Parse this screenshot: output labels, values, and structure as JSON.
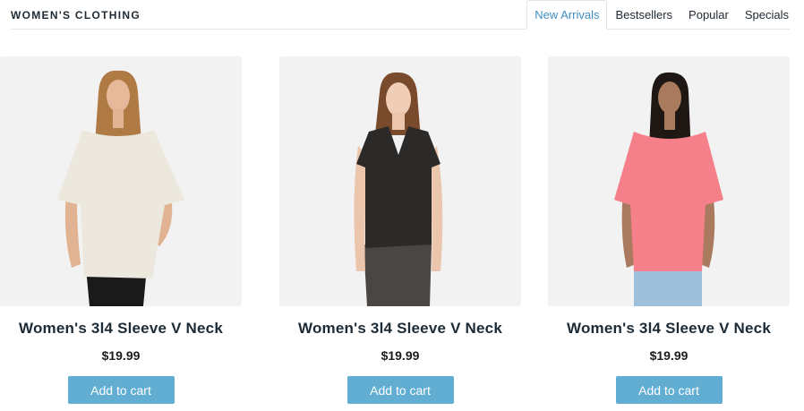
{
  "header": {
    "brand": "WOMEN'S CLOTHING",
    "tabs": [
      {
        "label": "New Arrivals",
        "active": true
      },
      {
        "label": "Bestsellers",
        "active": false
      },
      {
        "label": "Popular",
        "active": false
      },
      {
        "label": "Specials",
        "active": false
      }
    ]
  },
  "products": [
    {
      "title": "Women's 3l4 Sleeve V Neck",
      "price": "$19.99",
      "button": "Add to cart",
      "image": "model-black-top-photo",
      "top_color": "#2b2a28"
    },
    {
      "title": "Women's 3l4 Sleeve V Neck",
      "price": "$19.99",
      "button": "Add to cart",
      "image": "model-coral-top-photo",
      "top_color": "#f5808a"
    },
    {
      "title": "Women's 3l4 Sleeve V Neck",
      "price": "$19.99",
      "button": "Add to cart",
      "image": "model-cream-top-photo",
      "top_color": "#ece8dd"
    }
  ],
  "colors": {
    "accent": "#3f8ec4",
    "button": "#62aed3",
    "image_bg": "#f2f2f2"
  }
}
